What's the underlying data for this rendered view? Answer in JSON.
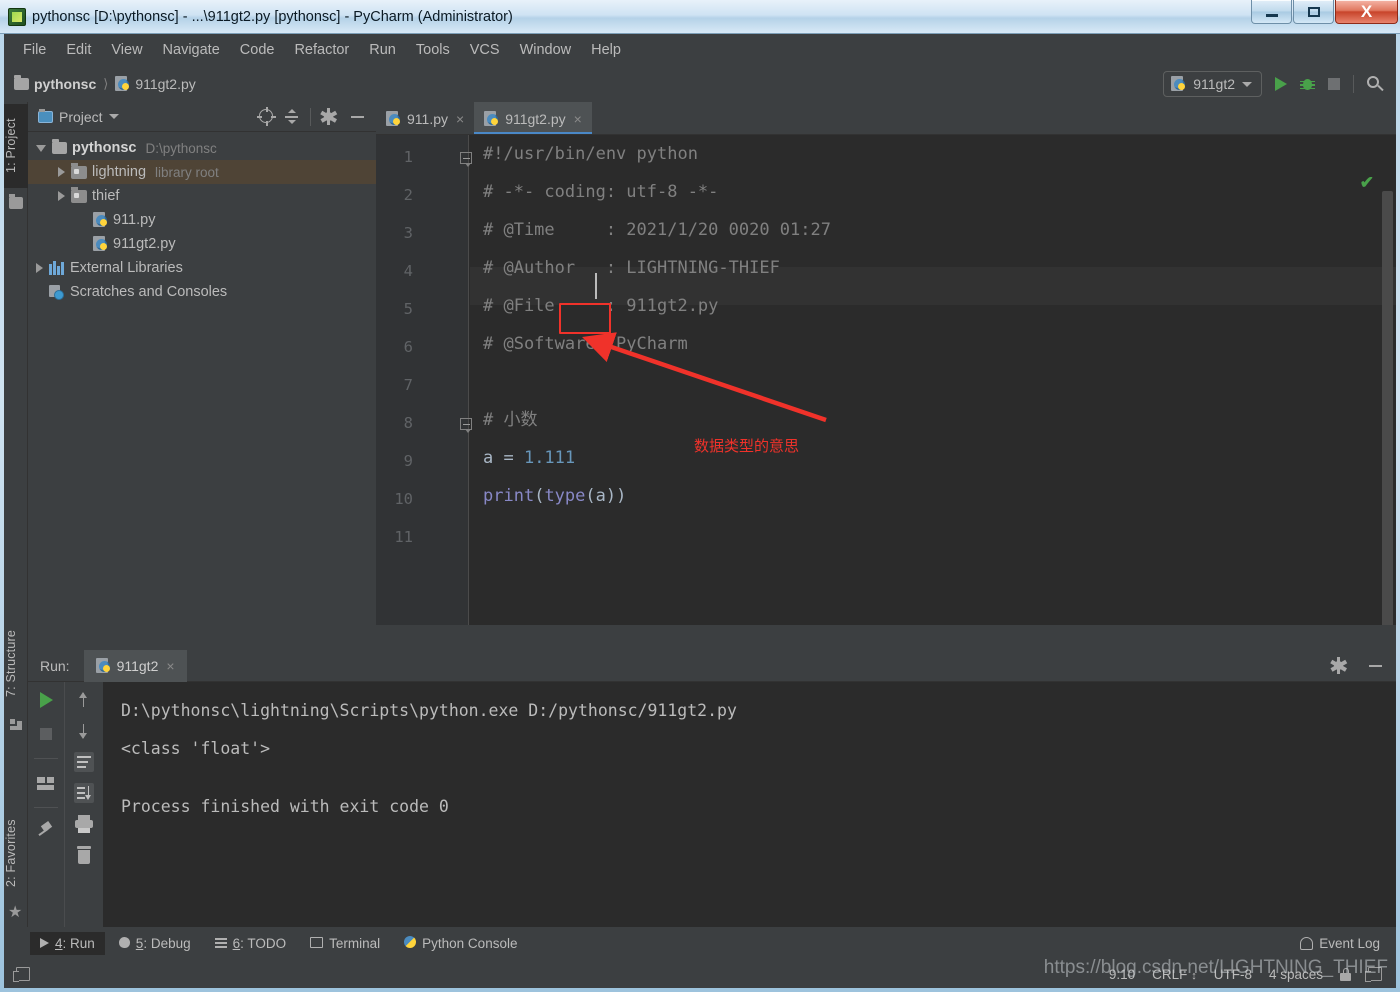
{
  "window": {
    "title": "pythonsc [D:\\pythonsc] - ...\\911gt2.py [pythonsc] - PyCharm (Administrator)",
    "app_icon": "pycharm-icon",
    "minimize_label": "Minimize",
    "maximize_label": "Maximize",
    "close_label": "X"
  },
  "menubar": {
    "items": [
      {
        "label": "File",
        "mnemonic": "F"
      },
      {
        "label": "Edit",
        "mnemonic": "E"
      },
      {
        "label": "View",
        "mnemonic": "V"
      },
      {
        "label": "Navigate",
        "mnemonic": "N"
      },
      {
        "label": "Code",
        "mnemonic": "C"
      },
      {
        "label": "Refactor",
        "mnemonic": "R"
      },
      {
        "label": "Run",
        "mnemonic": "u"
      },
      {
        "label": "Tools",
        "mnemonic": "T"
      },
      {
        "label": "VCS",
        "mnemonic": "S"
      },
      {
        "label": "Window",
        "mnemonic": "W"
      },
      {
        "label": "Help",
        "mnemonic": "H"
      }
    ]
  },
  "navbar": {
    "breadcrumbs": [
      "pythonsc",
      "911gt2.py"
    ],
    "run_config": "911gt2",
    "buttons": [
      "run-button",
      "debug-button",
      "stop-button",
      "search-everywhere-button"
    ]
  },
  "left_tool_tabs": [
    {
      "label": "1: Project",
      "active": true
    },
    {
      "label": "7: Structure",
      "active": false
    },
    {
      "label": "2: Favorites",
      "active": false
    }
  ],
  "project_panel": {
    "title": "Project",
    "toolbar": [
      "locate-icon",
      "collapse-all-icon",
      "settings-gear-icon",
      "hide-icon"
    ],
    "tree": [
      {
        "label": "pythonsc",
        "sub": "D:\\pythonsc",
        "icon": "folder-icon",
        "expanded": true,
        "depth": 0,
        "bold": true,
        "selected": false
      },
      {
        "label": "lightning",
        "sub": "library root",
        "icon": "module-folder-icon",
        "expanded": false,
        "depth": 1,
        "bold": false,
        "selected": true
      },
      {
        "label": "thief",
        "sub": "",
        "icon": "module-folder-icon",
        "expanded": false,
        "depth": 1,
        "bold": false,
        "selected": false
      },
      {
        "label": "911.py",
        "sub": "",
        "icon": "python-file-icon",
        "expanded": null,
        "depth": 2,
        "bold": false,
        "selected": false
      },
      {
        "label": "911gt2.py",
        "sub": "",
        "icon": "python-file-icon",
        "expanded": null,
        "depth": 2,
        "bold": false,
        "selected": false
      },
      {
        "label": "External Libraries",
        "sub": "",
        "icon": "libraries-icon",
        "expanded": false,
        "depth": 0,
        "bold": false,
        "selected": false
      },
      {
        "label": "Scratches and Consoles",
        "sub": "",
        "icon": "scratches-icon",
        "expanded": null,
        "depth": 0,
        "bold": false,
        "selected": false
      }
    ]
  },
  "editor": {
    "tabs": [
      {
        "label": "911.py",
        "active": false
      },
      {
        "label": "911gt2.py",
        "active": true
      }
    ],
    "line_numbers": [
      "1",
      "2",
      "3",
      "4",
      "5",
      "6",
      "7",
      "8",
      "9",
      "10",
      "11"
    ],
    "lines": [
      {
        "num": 1,
        "tokens": [
          {
            "t": "#!/usr/bin/env python",
            "c": "comment"
          }
        ]
      },
      {
        "num": 2,
        "tokens": [
          {
            "t": "# -*- coding: utf-8 -*-",
            "c": "comment"
          }
        ]
      },
      {
        "num": 3,
        "tokens": [
          {
            "t": "# @Time     : 2021/1/20 0020 01:27",
            "c": "comment"
          }
        ]
      },
      {
        "num": 4,
        "tokens": [
          {
            "t": "# @Author   : LIGHTNING-THIEF",
            "c": "comment"
          }
        ]
      },
      {
        "num": 5,
        "tokens": [
          {
            "t": "# @File     : 911gt2.py",
            "c": "comment"
          }
        ]
      },
      {
        "num": 6,
        "tokens": [
          {
            "t": "# @Software: PyCharm",
            "c": "comment"
          }
        ]
      },
      {
        "num": 7,
        "tokens": []
      },
      {
        "num": 8,
        "tokens": [
          {
            "t": "# 小数",
            "c": "comment"
          }
        ]
      },
      {
        "num": 9,
        "tokens": [
          {
            "t": "a = ",
            "c": "plain"
          },
          {
            "t": "1.111",
            "c": "num"
          }
        ]
      },
      {
        "num": 10,
        "tokens": [
          {
            "t": "print",
            "c": "kw-fn"
          },
          {
            "t": "(",
            "c": "plain"
          },
          {
            "t": "type",
            "c": "kw-fn"
          },
          {
            "t": "(a))",
            "c": "plain"
          }
        ]
      },
      {
        "num": 11,
        "tokens": []
      }
    ],
    "annotation": {
      "text": "数据类型的意思",
      "highlight_token": "type",
      "color": "#f0322a"
    },
    "inspection_status": "✔"
  },
  "run_panel": {
    "label": "Run:",
    "tab": "911gt2",
    "header_buttons": [
      "settings-gear-icon",
      "hide-icon"
    ],
    "toolbar_left": [
      "rerun-icon",
      "stop-icon",
      "layout-icon",
      "pin-icon"
    ],
    "toolbar_right": [
      "up-icon",
      "down-icon",
      "soft-wrap-icon",
      "scroll-to-end-icon",
      "print-icon",
      "clear-all-icon"
    ],
    "console_lines": [
      "D:\\pythonsc\\lightning\\Scripts\\python.exe D:/pythonsc/911gt2.py",
      "<class 'float'>",
      "",
      "Process finished with exit code 0"
    ]
  },
  "bottom_bar": {
    "buttons": [
      {
        "label": "4: Run",
        "icon": "run-icon",
        "active": true
      },
      {
        "label": "5: Debug",
        "icon": "debug-icon",
        "active": false
      },
      {
        "label": "6: TODO",
        "icon": "todo-icon",
        "active": false
      },
      {
        "label": "Terminal",
        "icon": "terminal-icon",
        "active": false
      },
      {
        "label": "Python Console",
        "icon": "python-icon",
        "active": false
      }
    ],
    "event_log": "Event Log"
  },
  "status_bar": {
    "caret_position": "9:10",
    "line_separator": "CRLF",
    "encoding": "UTF-8",
    "indent": "4 spaces",
    "lock_icon": "lock-icon"
  },
  "watermark": "https://blog.csdn.net/LIGHTNING_THIEF",
  "colors": {
    "bg_editor": "#2b2b2b",
    "bg_panel": "#3c3f41",
    "selection": "#4f4436",
    "accent_tab": "#4a88c7",
    "comment": "#808080",
    "number": "#6897bb",
    "function": "#8888c6",
    "text": "#a9b7c6",
    "annotation_red": "#f0322a",
    "run_green": "#49a14a"
  }
}
